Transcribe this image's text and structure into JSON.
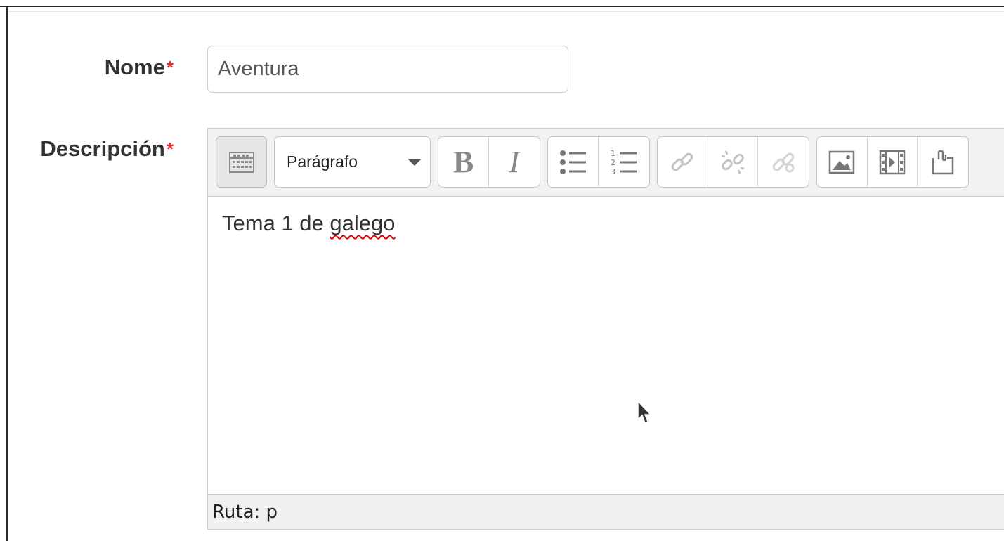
{
  "form": {
    "nome": {
      "label": "Nome",
      "required_mark": "*",
      "value": "Aventura"
    },
    "descricion": {
      "label": "Descripción",
      "required_mark": "*"
    }
  },
  "editor": {
    "toolbar": {
      "format_select": "Parágrafo",
      "buttons": [
        "toolbar-toggle-icon",
        "bold-icon",
        "italic-icon",
        "unordered-list-icon",
        "ordered-list-icon",
        "link-icon",
        "unlink-icon",
        "manage-links-icon",
        "image-icon",
        "media-icon",
        "manage-files-icon"
      ]
    },
    "content": {
      "text_before": "Tema 1 de ",
      "misspelled_word": "galego"
    },
    "path": "Ruta: p"
  },
  "colors": {
    "required": "#e8302e",
    "spellcheck": "#e00000"
  }
}
